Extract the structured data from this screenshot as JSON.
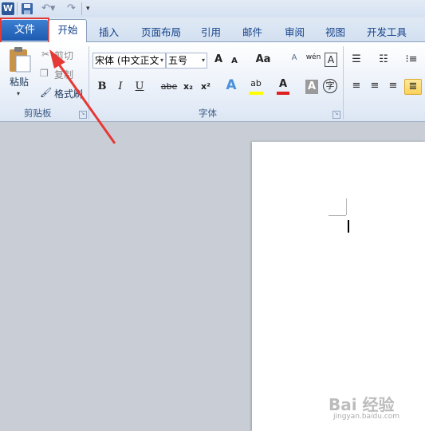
{
  "app": {
    "logo": "W"
  },
  "qat": {
    "more": "▾"
  },
  "tabs": {
    "file": "文件",
    "home": "开始",
    "items": [
      "插入",
      "页面布局",
      "引用",
      "邮件",
      "审阅",
      "视图",
      "开发工具"
    ]
  },
  "clipboard": {
    "paste": "粘贴",
    "cut": "剪切",
    "copy": "复制",
    "format_painter": "格式刷",
    "group": "剪贴板"
  },
  "font": {
    "family": "宋体 (中文正文",
    "size": "五号",
    "grow": "A",
    "shrink": "A",
    "change_case": "Aa",
    "clear_format": "A",
    "phonetic": "wén",
    "char_border": "A",
    "bold": "B",
    "italic": "I",
    "underline": "U",
    "strike": "abe",
    "sub": "x₂",
    "sup": "x²",
    "effects": "A",
    "highlight": "ab",
    "font_color": "A",
    "char_shade": "A",
    "enclose": "字",
    "group": "字体"
  },
  "colors": {
    "file_tab": "#1d5bb0",
    "highlight_box": "#e53935",
    "font_color_bar": "#e02020",
    "highlight_bar": "#ffff00"
  },
  "watermark": {
    "text": "Bai 经验",
    "url": "jingyan.baidu.com"
  }
}
